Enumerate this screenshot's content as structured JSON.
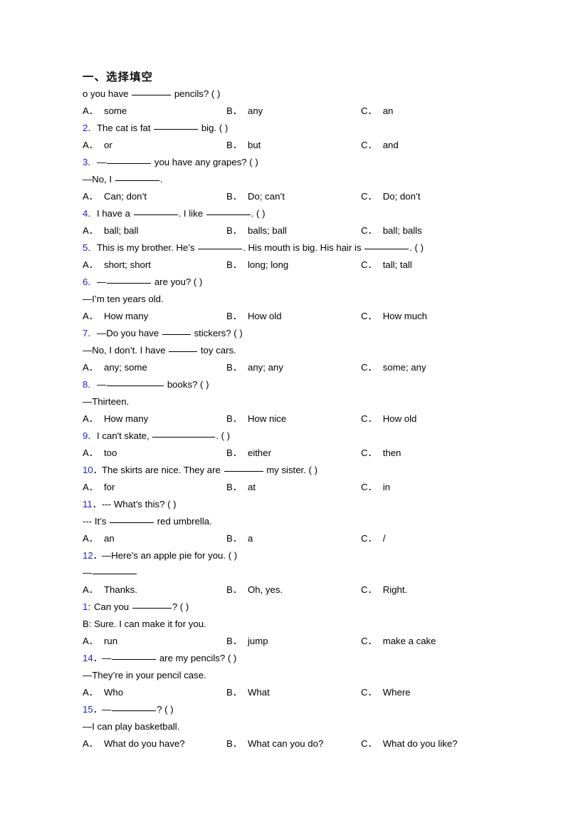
{
  "page": {
    "background": "#ffffff",
    "text_color": "#000000",
    "number_color": "#1b1bd6"
  },
  "section": {
    "title": "一、选择填空"
  },
  "questions": [
    {
      "number": "",
      "number_sep": "",
      "stem": "o you have ______ pencils? ( )",
      "stem_parts": [
        "o you have ",
        " pencils? ( )"
      ],
      "continuation": null,
      "options": [
        {
          "letter": "A．",
          "text": "some"
        },
        {
          "letter": "B．",
          "text": "any"
        },
        {
          "letter": "C．",
          "text": "an"
        }
      ]
    },
    {
      "number": "2",
      "number_sep": ".",
      "stem": "The cat is fat ________ big. ( )",
      "stem_parts": [
        "The cat is fat ",
        " big. ( )"
      ],
      "continuation": null,
      "options": [
        {
          "letter": "A．",
          "text": "or"
        },
        {
          "letter": "B．",
          "text": "but"
        },
        {
          "letter": "C．",
          "text": "and"
        }
      ]
    },
    {
      "number": "3",
      "number_sep": ".",
      "stem": "—________ you have any grapes? ( )",
      "stem_parts": [
        "—",
        " you have any grapes? ( )"
      ],
      "continuation": "—No, I ________.",
      "continuation_parts": [
        "—No, I ",
        "."
      ],
      "options": [
        {
          "letter": "A．",
          "text": "Can; don’t"
        },
        {
          "letter": "B．",
          "text": "Do; can’t"
        },
        {
          "letter": "C．",
          "text": "Do; don’t"
        }
      ]
    },
    {
      "number": "4",
      "number_sep": ".",
      "stem": "I have a ________. I like ________. ( )",
      "stem_parts": [
        "I have a ",
        ". I like ",
        ". ( )"
      ],
      "continuation": null,
      "options": [
        {
          "letter": "A．",
          "text": "ball; ball"
        },
        {
          "letter": "B．",
          "text": "balls; ball"
        },
        {
          "letter": "C．",
          "text": "ball; balls"
        }
      ]
    },
    {
      "number": "5",
      "number_sep": ".",
      "stem": "This is my brother. He’s ________. His mouth is big. His hair is ________. ( )",
      "stem_parts": [
        "This is my brother. He’s ",
        ". His mouth is big. His hair is ",
        ". ( )"
      ],
      "continuation": null,
      "options": [
        {
          "letter": "A．",
          "text": "short; short"
        },
        {
          "letter": "B．",
          "text": "long; long"
        },
        {
          "letter": "C．",
          "text": "tall; tall"
        }
      ]
    },
    {
      "number": "6",
      "number_sep": ".",
      "stem": "—________ are you? ( )",
      "stem_parts": [
        "—",
        " are you? ( )"
      ],
      "continuation": "—I’m ten years old.",
      "options": [
        {
          "letter": "A．",
          "text": "How many"
        },
        {
          "letter": "B．",
          "text": "How old"
        },
        {
          "letter": "C．",
          "text": "How much"
        }
      ]
    },
    {
      "number": "7",
      "number_sep": ".",
      "stem": "—Do you have _____ stickers? ( )",
      "stem_parts": [
        "—Do you have ",
        " stickers? ( )"
      ],
      "continuation": "—No, I don’t. I have _____ toy cars.",
      "continuation_parts": [
        "—No, I don’t. I have ",
        " toy cars."
      ],
      "options": [
        {
          "letter": "A．",
          "text": "any; some"
        },
        {
          "letter": "B．",
          "text": "any; any"
        },
        {
          "letter": "C．",
          "text": "some; any"
        }
      ]
    },
    {
      "number": "8",
      "number_sep": ".",
      "stem": "—___________ books? ( )",
      "stem_parts": [
        "—",
        " books? ( )"
      ],
      "continuation": "—Thirteen.",
      "options": [
        {
          "letter": "A．",
          "text": "How many"
        },
        {
          "letter": "B．",
          "text": "How nice"
        },
        {
          "letter": "C．",
          "text": "How old"
        }
      ]
    },
    {
      "number": "9",
      "number_sep": ".",
      "stem": "I can't skate, ____________. ( )",
      "stem_parts": [
        "I can't skate, ",
        ". ( )"
      ],
      "continuation": null,
      "options": [
        {
          "letter": "A．",
          "text": "too"
        },
        {
          "letter": "B．",
          "text": "either"
        },
        {
          "letter": "C．",
          "text": "then"
        }
      ]
    },
    {
      "number": "10",
      "number_sep": "．",
      "stem": "The skirts are nice. They are ______ my sister. ( )",
      "stem_parts": [
        "The skirts are nice. They are ",
        " my sister. ( )"
      ],
      "continuation": null,
      "options": [
        {
          "letter": "A．",
          "text": "for"
        },
        {
          "letter": "B．",
          "text": "at"
        },
        {
          "letter": "C．",
          "text": "in"
        }
      ]
    },
    {
      "number": "11",
      "number_sep": "．",
      "stem": "--- What’s this? ( )",
      "stem_parts": [
        "--- What’s this? ( )"
      ],
      "continuation": "--- It’s ________ red umbrella.",
      "continuation_parts": [
        "--- It’s ",
        " red umbrella."
      ],
      "options": [
        {
          "letter": "A．",
          "text": "an"
        },
        {
          "letter": "B．",
          "text": "a"
        },
        {
          "letter": "C．",
          "text": "/"
        }
      ]
    },
    {
      "number": "12",
      "number_sep": "．",
      "stem": "—Here's an apple pie for you. ( )",
      "stem_parts": [
        "—Here's an apple pie for you. ( )"
      ],
      "continuation": "—_________",
      "continuation_parts": [
        "—",
        ""
      ],
      "options": [
        {
          "letter": "A．",
          "text": "Thanks."
        },
        {
          "letter": "B．",
          "text": "Oh, yes."
        },
        {
          "letter": "C．",
          "text": "Right."
        }
      ]
    },
    {
      "number": "1",
      "number_sep": ":",
      "stem": "Can you _______? ( )",
      "stem_parts": [
        "Can you ",
        "? ( )"
      ],
      "continuation": "B: Sure. I can make it for you.",
      "options": [
        {
          "letter": "A．",
          "text": "run"
        },
        {
          "letter": "B．",
          "text": "jump"
        },
        {
          "letter": "C．",
          "text": "make a cake"
        }
      ]
    },
    {
      "number": "14",
      "number_sep": "．",
      "stem": "—________ are my pencils? ( )",
      "stem_parts": [
        "—",
        " are my pencils? ( )"
      ],
      "continuation": "—They’re in your pencil case.",
      "options": [
        {
          "letter": "A．",
          "text": "Who"
        },
        {
          "letter": "B．",
          "text": "What"
        },
        {
          "letter": "C．",
          "text": "Where"
        }
      ]
    },
    {
      "number": "15",
      "number_sep": "．",
      "stem": "—_______? ( )",
      "stem_parts": [
        "—",
        "? ( )"
      ],
      "continuation": "—I can play basketball.",
      "options": [
        {
          "letter": "A．",
          "text": "What do you have?"
        },
        {
          "letter": "B．",
          "text": "What can you do?"
        },
        {
          "letter": "C．",
          "text": "What do you like?"
        }
      ]
    }
  ]
}
